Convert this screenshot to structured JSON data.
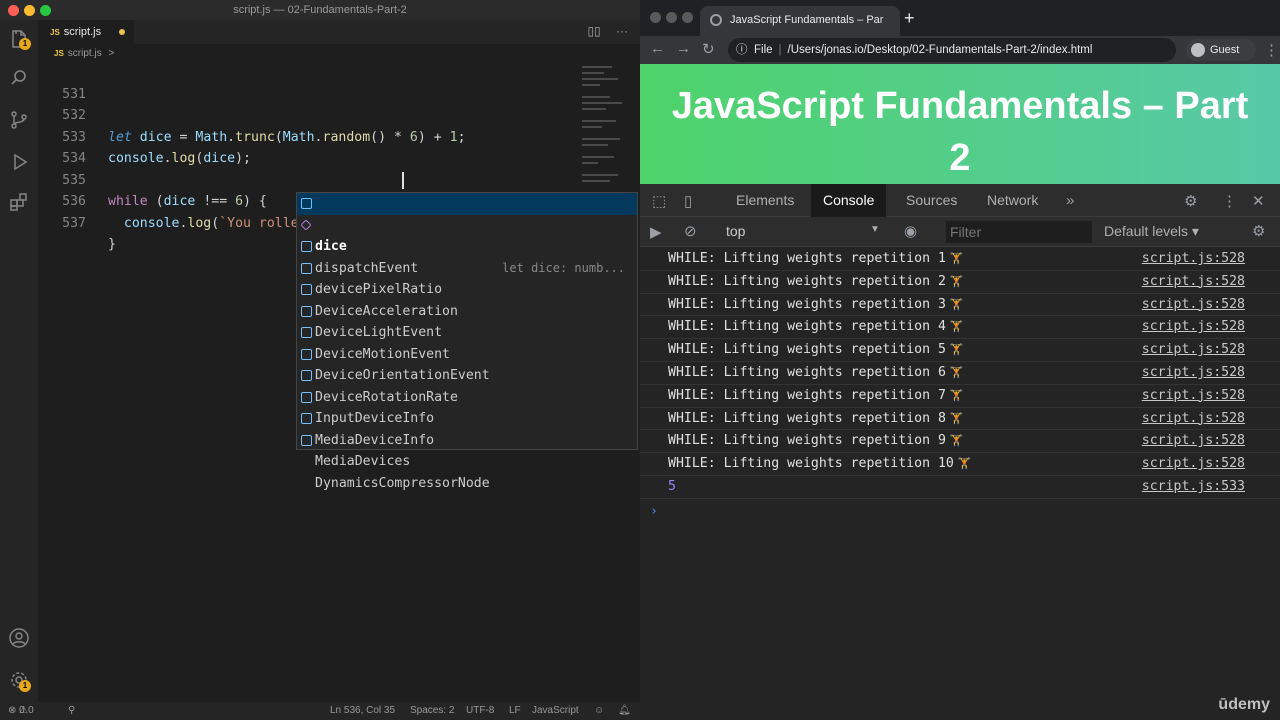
{
  "editor": {
    "window_title": "script.js — 02-Fundamentals-Part-2",
    "tab_label": "script.js",
    "tab_lang_badge": "JS",
    "breadcrumb_file": "script.js",
    "breadcrumb_sep": ">",
    "explorer_badge": "1",
    "accounts_badge": "1",
    "lines": [
      {
        "num": "531",
        "code": ""
      },
      {
        "num": "532",
        "code": "let dice = Math.trunc(Math.random() * 6) + 1;"
      },
      {
        "num": "533",
        "code": "console.log(dice);"
      },
      {
        "num": "534",
        "code": ""
      },
      {
        "num": "535",
        "code": "while (dice !== 6) {"
      },
      {
        "num": "536",
        "code": "  console.log(`You rolled a ${dice}`)"
      },
      {
        "num": "537",
        "code": "}"
      }
    ],
    "suggestions": [
      {
        "label": "dice",
        "kind": "variable",
        "detail": "let dice: numb..."
      },
      {
        "label": "dispatchEvent",
        "kind": "method",
        "detail": ""
      },
      {
        "label": "devicePixelRatio",
        "kind": "variable",
        "detail": ""
      },
      {
        "label": "DeviceAcceleration",
        "kind": "variable",
        "detail": ""
      },
      {
        "label": "DeviceLightEvent",
        "kind": "variable",
        "detail": ""
      },
      {
        "label": "DeviceMotionEvent",
        "kind": "variable",
        "detail": ""
      },
      {
        "label": "DeviceOrientationEvent",
        "kind": "variable",
        "detail": ""
      },
      {
        "label": "DeviceRotationRate",
        "kind": "variable",
        "detail": ""
      },
      {
        "label": "InputDeviceInfo",
        "kind": "variable",
        "detail": ""
      },
      {
        "label": "MediaDeviceInfo",
        "kind": "variable",
        "detail": ""
      },
      {
        "label": "MediaDevices",
        "kind": "variable",
        "detail": ""
      },
      {
        "label": "DynamicsCompressorNode",
        "kind": "variable",
        "detail": ""
      }
    ],
    "status": {
      "errors": "0",
      "warnings": "0",
      "position": "Ln 536, Col 35",
      "spaces": "Spaces: 2",
      "encoding": "UTF-8",
      "eol": "LF",
      "language": "JavaScript"
    }
  },
  "browser": {
    "tab_title": "JavaScript Fundamentals – Par",
    "url_scheme": "File",
    "url": "/Users/jonas.io/Desktop/02-Fundamentals-Part-2/index.html",
    "profile": "Guest",
    "page_title": "JavaScript Fundamentals – Part 2"
  },
  "devtools": {
    "tabs": [
      "Elements",
      "Console",
      "Sources",
      "Network"
    ],
    "active_tab": "Console",
    "context": "top",
    "filter_placeholder": "Filter",
    "levels": "Default levels",
    "logs": [
      {
        "text": "WHILE: Lifting weights repetition 1",
        "emoji": "🏋",
        "source": "script.js:528"
      },
      {
        "text": "WHILE: Lifting weights repetition 2",
        "emoji": "🏋",
        "source": "script.js:528"
      },
      {
        "text": "WHILE: Lifting weights repetition 3",
        "emoji": "🏋",
        "source": "script.js:528"
      },
      {
        "text": "WHILE: Lifting weights repetition 4",
        "emoji": "🏋",
        "source": "script.js:528"
      },
      {
        "text": "WHILE: Lifting weights repetition 5",
        "emoji": "🏋",
        "source": "script.js:528"
      },
      {
        "text": "WHILE: Lifting weights repetition 6",
        "emoji": "🏋",
        "source": "script.js:528"
      },
      {
        "text": "WHILE: Lifting weights repetition 7",
        "emoji": "🏋",
        "source": "script.js:528"
      },
      {
        "text": "WHILE: Lifting weights repetition 8",
        "emoji": "🏋",
        "source": "script.js:528"
      },
      {
        "text": "WHILE: Lifting weights repetition 9",
        "emoji": "🏋",
        "source": "script.js:528"
      },
      {
        "text": "WHILE: Lifting weights repetition 10",
        "emoji": "🏋",
        "source": "script.js:528"
      },
      {
        "text": "5",
        "emoji": "",
        "source": "script.js:533"
      }
    ],
    "prompt": "›"
  },
  "watermark": "ūdemy"
}
